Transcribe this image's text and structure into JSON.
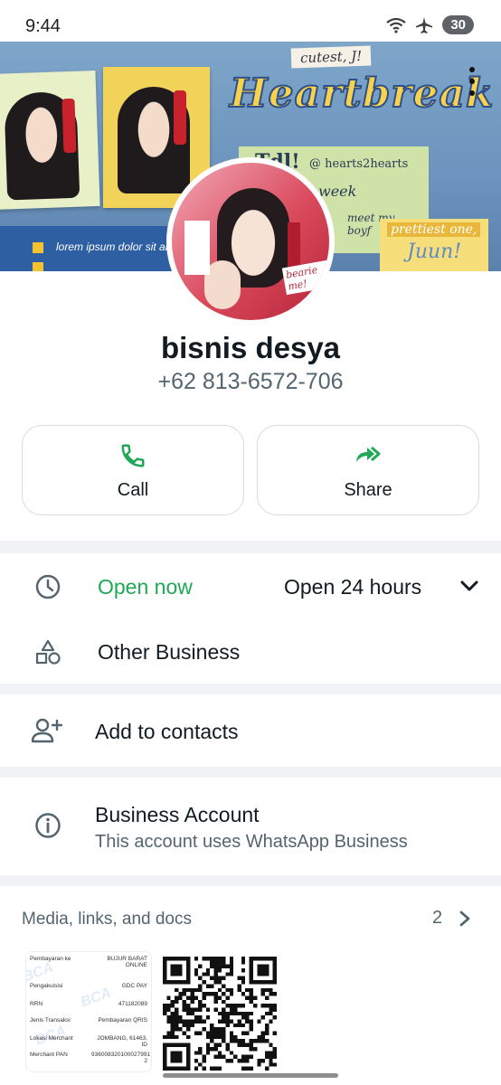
{
  "status_bar": {
    "time": "9:44",
    "battery": "30"
  },
  "banner": {
    "cutest": "cutest, J!",
    "title": "Heartbreak",
    "handle": "@ hearts2hearts",
    "week": "week",
    "meet": "meet my boyf",
    "lorem": "lorem ipsum dolor sit amet",
    "prettiest": "prettiest one,",
    "juun": "Juun!"
  },
  "profile": {
    "name": "bisnis desya",
    "phone": "+62 813-6572-706"
  },
  "actions": {
    "call_label": "Call",
    "share_label": "Share"
  },
  "hours": {
    "status": "Open now",
    "schedule": "Open 24 hours"
  },
  "category": "Other Business",
  "contacts": {
    "label": "Add to contacts"
  },
  "business": {
    "title": "Business Account",
    "subtitle": "This account uses WhatsApp Business"
  },
  "media": {
    "title": "Media, links, and docs",
    "count": "2",
    "receipt": [
      {
        "label": "Pembayaran ke",
        "value": "BUJUR BARAT ONLINE"
      },
      {
        "label": "Pengakuisisi",
        "value": "GDC PAY"
      },
      {
        "label": "RRN",
        "value": "471182089"
      },
      {
        "label": "Jenis Transaksi",
        "value": "Pembayaran QRIS"
      },
      {
        "label": "Lokasi Merchant",
        "value": "JOMBANG, 61463, ID"
      },
      {
        "label": "Merchant PAN",
        "value": "936008320100027991 2"
      }
    ],
    "receipt_watermark": "BCA"
  },
  "colors": {
    "green": "#1fa855",
    "text": "#111b21",
    "secondary": "#54656f",
    "divider": "#f0f2f5"
  },
  "icons": [
    "back-arrow-icon",
    "more-vert-icon",
    "phone-icon",
    "share-forward-icon",
    "clock-icon",
    "shapes-icon",
    "chevron-down-icon",
    "add-person-icon",
    "info-icon",
    "chevron-right-icon"
  ]
}
